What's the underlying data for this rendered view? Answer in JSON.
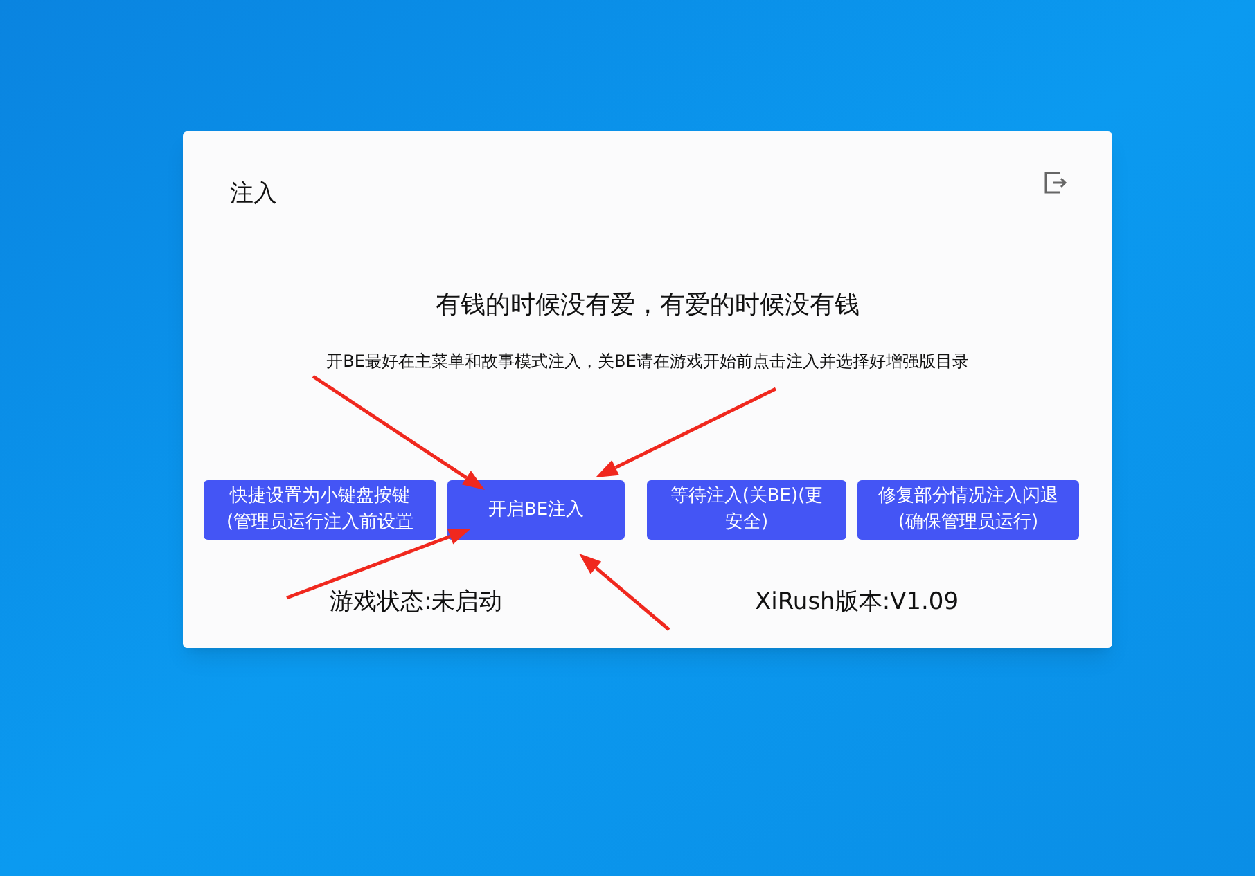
{
  "window": {
    "title": "注入"
  },
  "headline": "有钱的时候没有爱，有爱的时候没有钱",
  "hint": "开BE最好在主菜单和故事模式注入，关BE请在游戏开始前点击注入并选择好增强版目录",
  "buttons": [
    {
      "lines": [
        "快捷设置为小键盘按键",
        "(管理员运行注入前设置"
      ]
    },
    {
      "lines": [
        "开启BE注入"
      ]
    },
    {
      "lines": [
        "等待注入(关BE)(更",
        "安全)"
      ]
    },
    {
      "lines": [
        "修复部分情况注入闪退",
        "(确保管理员运行)"
      ]
    }
  ],
  "status": {
    "game_state": "游戏状态:未启动",
    "version": "XiRush版本:V1.09"
  }
}
